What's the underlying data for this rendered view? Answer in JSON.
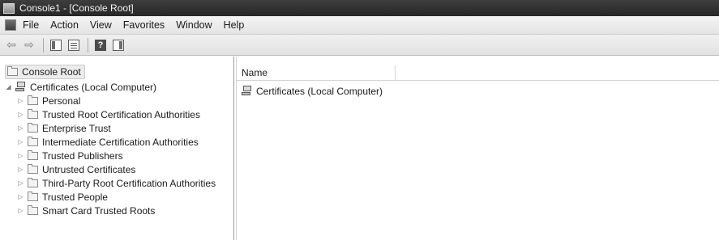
{
  "window": {
    "title": "Console1 - [Console Root]"
  },
  "menubar": {
    "items": [
      "File",
      "Action",
      "View",
      "Favorites",
      "Window",
      "Help"
    ]
  },
  "toolbar": {
    "back_icon": "back-arrow-icon",
    "forward_icon": "forward-arrow-icon",
    "help_label": "?"
  },
  "tree": {
    "root": "Console Root",
    "computer": "Certificates (Local Computer)",
    "stores": [
      "Personal",
      "Trusted Root Certification Authorities",
      "Enterprise Trust",
      "Intermediate Certification Authorities",
      "Trusted Publishers",
      "Untrusted Certificates",
      "Third-Party Root Certification Authorities",
      "Trusted People",
      "Smart Card Trusted Roots"
    ]
  },
  "list": {
    "columns": [
      "Name"
    ],
    "rows": [
      "Certificates (Local Computer)"
    ]
  }
}
